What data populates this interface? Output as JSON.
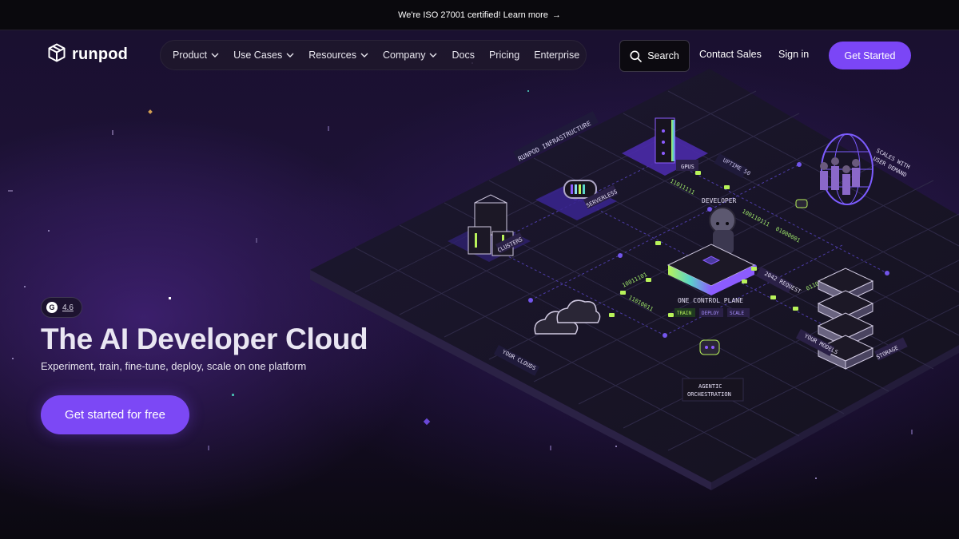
{
  "announcement": {
    "text": "We're ISO 27001 certified! Learn more",
    "arrow": "→"
  },
  "brand": {
    "name": "runpod",
    "logo_icon": "cube-icon"
  },
  "nav": {
    "items": [
      {
        "label": "Product",
        "dropdown": true
      },
      {
        "label": "Use Cases",
        "dropdown": true
      },
      {
        "label": "Resources",
        "dropdown": true
      },
      {
        "label": "Company",
        "dropdown": true
      },
      {
        "label": "Docs",
        "dropdown": false
      },
      {
        "label": "Pricing",
        "dropdown": false
      },
      {
        "label": "Enterprise",
        "dropdown": false
      }
    ]
  },
  "header_actions": {
    "search_label": "Search",
    "contact_label": "Contact Sales",
    "signin_label": "Sign in",
    "get_started_label": "Get Started"
  },
  "hero": {
    "rating_badge": "G",
    "rating_value": "4.6",
    "title": "The AI Developer Cloud",
    "subtitle": "Experiment, train, fine-tune, deploy, scale on one platform",
    "cta_label": "Get started for free"
  },
  "diagram": {
    "infra_label": "RUNPOD INFRASTRUCTURE",
    "gpus_label": "GPUS",
    "uptime_label": "UPTIME 50",
    "serverless_label": "SERVERLESS",
    "clusters_label": "CLUSTERS",
    "developer_label": "DEVELOPER",
    "scales_label_1": "SCALES WITH",
    "scales_label_2": "USER DEMAND",
    "control_plane_label": "ONE CONTROL PLANE",
    "train_label": "TRAIN",
    "deploy_label": "DEPLOY",
    "scale_label": "SCALE",
    "request_label": "2042 REQUEST",
    "your_clouds_label": "YOUR CLOUDS",
    "your_models_label": "YOUR MODELS",
    "storage_label": "STORAGE",
    "agentic_label_1": "AGENTIC",
    "agentic_label_2": "ORCHESTRATION",
    "binary_1": "11011111",
    "binary_2": "100110111",
    "binary_3": "01000001",
    "binary_4": "10011101",
    "binary_5": "01100111",
    "binary_6": "11010011"
  },
  "colors": {
    "accent": "#7b46f6",
    "background": "#0b0910",
    "glow": "#582ca0",
    "neon_green": "#b8f25a",
    "neon_purple": "#7c5cff"
  }
}
